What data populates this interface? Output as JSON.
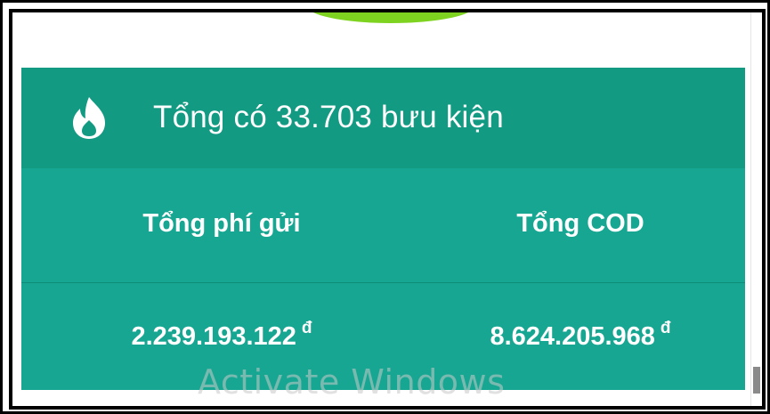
{
  "summary": {
    "title": "Tổng có 33.703 bưu kiện",
    "icon": "fire-icon",
    "columns": [
      {
        "label": "Tổng phí gửi",
        "value": "2.239.193.122",
        "currency": "đ"
      },
      {
        "label": "Tổng COD",
        "value": "8.624.205.968",
        "currency": "đ"
      }
    ]
  },
  "overlay": {
    "watermark": "Activate Windows"
  },
  "colors": {
    "header": "#129a83",
    "body": "#16a692",
    "accent_green": "#7ed321"
  }
}
